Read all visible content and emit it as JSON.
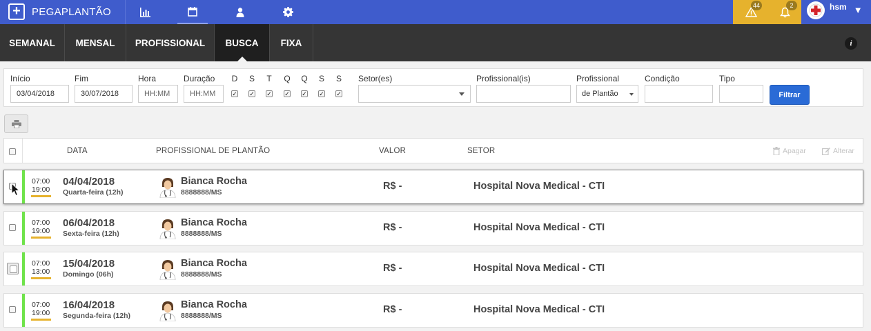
{
  "app": {
    "logo_text": "PEGAPLANTÃO",
    "logo_symbol": "+"
  },
  "topnav": {
    "icons": [
      "bar-chart-icon",
      "calendar-icon",
      "user-icon",
      "gear-icon"
    ],
    "active": "calendar-icon"
  },
  "alerts": {
    "warnings_count": "44",
    "notifications_count": "2"
  },
  "user": {
    "name": "hsm"
  },
  "tabs": [
    {
      "label": "SEMANAL"
    },
    {
      "label": "MENSAL"
    },
    {
      "label": "PROFISSIONAL"
    },
    {
      "label": "BUSCA",
      "active": true
    },
    {
      "label": "FIXA"
    }
  ],
  "filters": {
    "inicio_label": "Início",
    "inicio_value": "03/04/2018",
    "fim_label": "Fim",
    "fim_value": "30/07/2018",
    "hora_label": "Hora",
    "hora_placeholder": "HH:MM",
    "duracao_label": "Duração",
    "duracao_placeholder": "HH:MM",
    "days": [
      {
        "label": "D",
        "checked": true
      },
      {
        "label": "S",
        "checked": true
      },
      {
        "label": "T",
        "checked": true
      },
      {
        "label": "Q",
        "checked": true
      },
      {
        "label": "Q",
        "checked": true
      },
      {
        "label": "S",
        "checked": true
      },
      {
        "label": "S",
        "checked": true
      }
    ],
    "setores_label": "Setor(es)",
    "setores_value": "",
    "profissionais_label": "Profissional(is)",
    "profissionais_value": "",
    "profissional_label": "Profissional",
    "profissional_value": "de Plantão",
    "condicao_label": "Condição",
    "condicao_value": "",
    "tipo_label": "Tipo",
    "tipo_value": "",
    "filtrar_label": "Filtrar"
  },
  "table": {
    "headers": {
      "data": "DATA",
      "profissional": "PROFISSIONAL DE PLANTÃO",
      "valor": "VALOR",
      "setor": "SETOR"
    },
    "actions": {
      "apagar": "Apagar",
      "alterar": "Alterar"
    },
    "rows": [
      {
        "start": "07:00",
        "end": "19:00",
        "date": "04/04/2018",
        "weekday": "Quarta-feira (12h)",
        "name": "Bianca Rocha",
        "crm": "8888888/MS",
        "valor": "R$ -",
        "setor": "Hospital Nova Medical - CTI"
      },
      {
        "start": "07:00",
        "end": "19:00",
        "date": "06/04/2018",
        "weekday": "Sexta-feira (12h)",
        "name": "Bianca Rocha",
        "crm": "8888888/MS",
        "valor": "R$ -",
        "setor": "Hospital Nova Medical - CTI"
      },
      {
        "start": "07:00",
        "end": "13:00",
        "date": "15/04/2018",
        "weekday": "Domingo (06h)",
        "name": "Bianca Rocha",
        "crm": "8888888/MS",
        "valor": "R$ -",
        "setor": "Hospital Nova Medical - CTI"
      },
      {
        "start": "07:00",
        "end": "19:00",
        "date": "16/04/2018",
        "weekday": "Segunda-feira (12h)",
        "name": "Bianca Rocha",
        "crm": "8888888/MS",
        "valor": "R$ -",
        "setor": "Hospital Nova Medical - CTI"
      }
    ]
  },
  "colors": {
    "topbar": "#3f5ccc",
    "alerts": "#e6b22d",
    "tabbar": "#353535",
    "primary_button": "#2a6bd6",
    "shift_bar": "#6fe34a",
    "time_underline": "#e6b22d"
  }
}
